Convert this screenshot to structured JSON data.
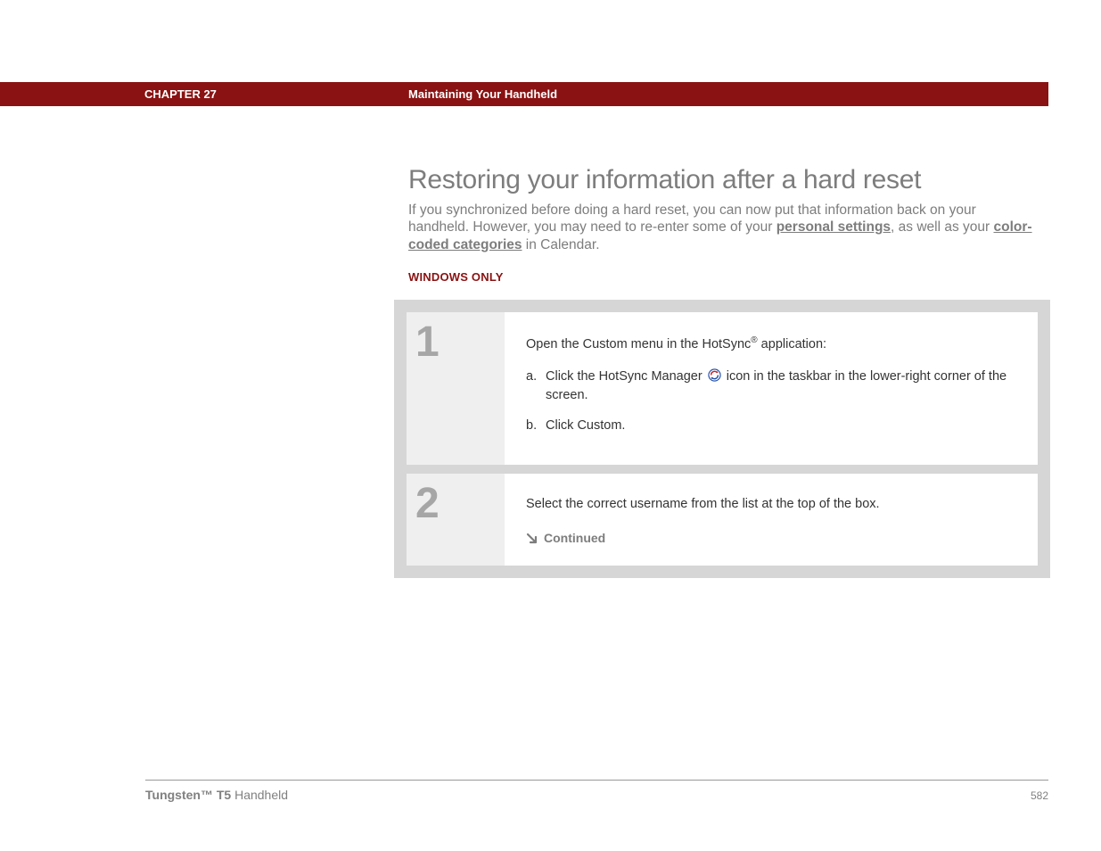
{
  "header": {
    "chapter": "CHAPTER 27",
    "title": "Maintaining Your Handheld"
  },
  "main": {
    "heading": "Restoring your information after a hard reset",
    "intro_prefix": "If you synchronized before doing a hard reset, you can now put that information back on your handheld. However, you may need to re-enter some of your ",
    "link1": "personal settings",
    "intro_mid": ", as well as your ",
    "link2": "color-coded categories",
    "intro_suffix": " in Calendar.",
    "platform_label": "WINDOWS ONLY"
  },
  "steps": [
    {
      "num": "1",
      "open_prefix": "Open the Custom menu in the HotSync",
      "reg": "®",
      "open_suffix": " application:",
      "sub": [
        {
          "letter": "a.",
          "before": "Click the HotSync Manager ",
          "after": " icon in the taskbar in the lower-right corner of the screen."
        },
        {
          "letter": "b.",
          "text": "Click Custom."
        }
      ]
    },
    {
      "num": "2",
      "text": "Select the correct username from the list at the top of the box.",
      "continued": "Continued"
    }
  ],
  "footer": {
    "product_bold": "Tungsten™ T5",
    "product_rest": " Handheld",
    "page": "582"
  }
}
